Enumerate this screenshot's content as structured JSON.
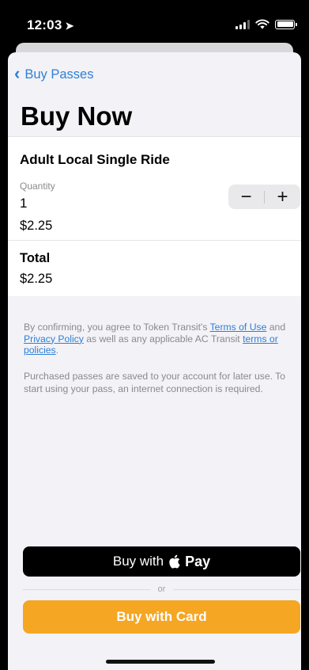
{
  "status_bar": {
    "time": "12:03"
  },
  "nav": {
    "back_label": "Buy Passes"
  },
  "page": {
    "title": "Buy Now"
  },
  "item": {
    "title": "Adult Local Single Ride",
    "quantity_label": "Quantity",
    "quantity": "1",
    "price": "$2.25",
    "stepper": {
      "minus": "−",
      "plus": "+"
    }
  },
  "total": {
    "label": "Total",
    "value": "$2.25"
  },
  "legal": {
    "part1": "By confirming, you agree to Token Transit's ",
    "terms_link": "Terms of Use",
    "part2": " and ",
    "privacy_link": "Privacy Policy",
    "part3": " as well as any applicable AC Transit ",
    "policies_link": "terms or policies",
    "part4": ".",
    "note": "Purchased passes are saved to your account for later use. To start using your pass, an internet connection is required."
  },
  "buttons": {
    "apple_pay_prefix": "Buy with",
    "apple_pay_word": "Pay",
    "or": "or",
    "card": "Buy with Card"
  },
  "colors": {
    "link": "#2f7fd6",
    "card_button": "#f5a623",
    "apple_pay_button": "#000000",
    "sheet_background": "#f2f2f7"
  }
}
